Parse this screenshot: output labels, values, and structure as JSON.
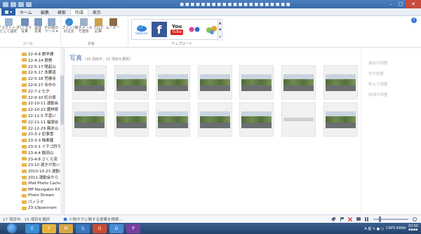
{
  "window": {
    "title": "■ ■ ■ ■ ■ ■ ■ ■ ■ ■ ■ ■ ■ ■ ■ ■ ■ ■ ■ ■ ■",
    "minimize": "–",
    "maximize": "□",
    "close": "✕"
  },
  "tabs": {
    "file": "■ ▾",
    "items": [
      "ホーム",
      "編集",
      "検索",
      "作成",
      "表示"
    ],
    "active_index": 3
  },
  "ribbon": {
    "buttons": [
      {
        "label": "デスクトップ\nとして設定",
        "color": "#9bb5d6"
      },
      {
        "label": "パノラマ\n写真",
        "color": "#6f8fb5"
      },
      {
        "label": "合成\n写真",
        "color": "#7a98c0"
      },
      {
        "label": "その他の\nツール ▾",
        "color": "#8fa8c8"
      },
      {
        "label": "プリント\nの注文",
        "color": "#3c8ad0"
      },
      {
        "label": "電子メール\nで送信",
        "color": "#9fb0c4"
      },
      {
        "label": "ブログ\n記事",
        "color": "#c9a24a"
      },
      {
        "label": "ムービー",
        "color": "#8b6a44"
      }
    ],
    "group_labels": [
      "ツール",
      "共有",
      "アップロード"
    ],
    "share": {
      "skydrive_label": "SkyDrive",
      "facebook": "f",
      "youtube_top": "You",
      "youtube_bottom": "Tube",
      "up": "▲",
      "down": "▼",
      "more": "▾"
    },
    "help": "?"
  },
  "nav": {
    "items": [
      "22-4-8 数学通",
      "22-4-14 琵琶",
      "22-5-17 隆起山",
      "22-5-17 本郷道",
      "22-5-18 荒廃寺",
      "22-6-17 寺中の",
      "22-7-2 七夕",
      "22-9-10 町の祭",
      "22-10-11 運動会",
      "22-10-23 農林祭",
      "22-11-3 手習い",
      "22-11-11 福徳谷",
      "22-12-29 霧氷山",
      "23-3-2 記事雪",
      "23-3-3 梅素園",
      "23-3-1 イチゴ狩り",
      "23-4-4 飯田山",
      "23-4-8 さくら流",
      "23-10 運きが良い",
      "2010-10-23 運動会",
      "2011 運動会から",
      "iPod Photo Cache",
      "MP Navigator EX",
      "Photo Stream",
      "パノラマ",
      "23-10panoram"
    ]
  },
  "content": {
    "title": "写真",
    "subtitle": "(16 項目中、15 項目を選択)",
    "photos_row1": 7,
    "photos_row2": 7
  },
  "details": [
    "撮影の調整",
    "色の調整",
    "明るさ調整",
    "詳細の調整"
  ],
  "status": {
    "left": "17 項目中、15 項目を選択",
    "info": "人物タグに関する提案を検索..."
  },
  "taskbar": {
    "icons": [
      "E",
      "F",
      "M",
      "S",
      "O",
      "G",
      "P"
    ],
    "lang": "A 般 ✎ ● ○",
    "caps": "CAPS KANA",
    "clock_time": "20:50",
    "clock_date": "▪▪▪▪"
  }
}
